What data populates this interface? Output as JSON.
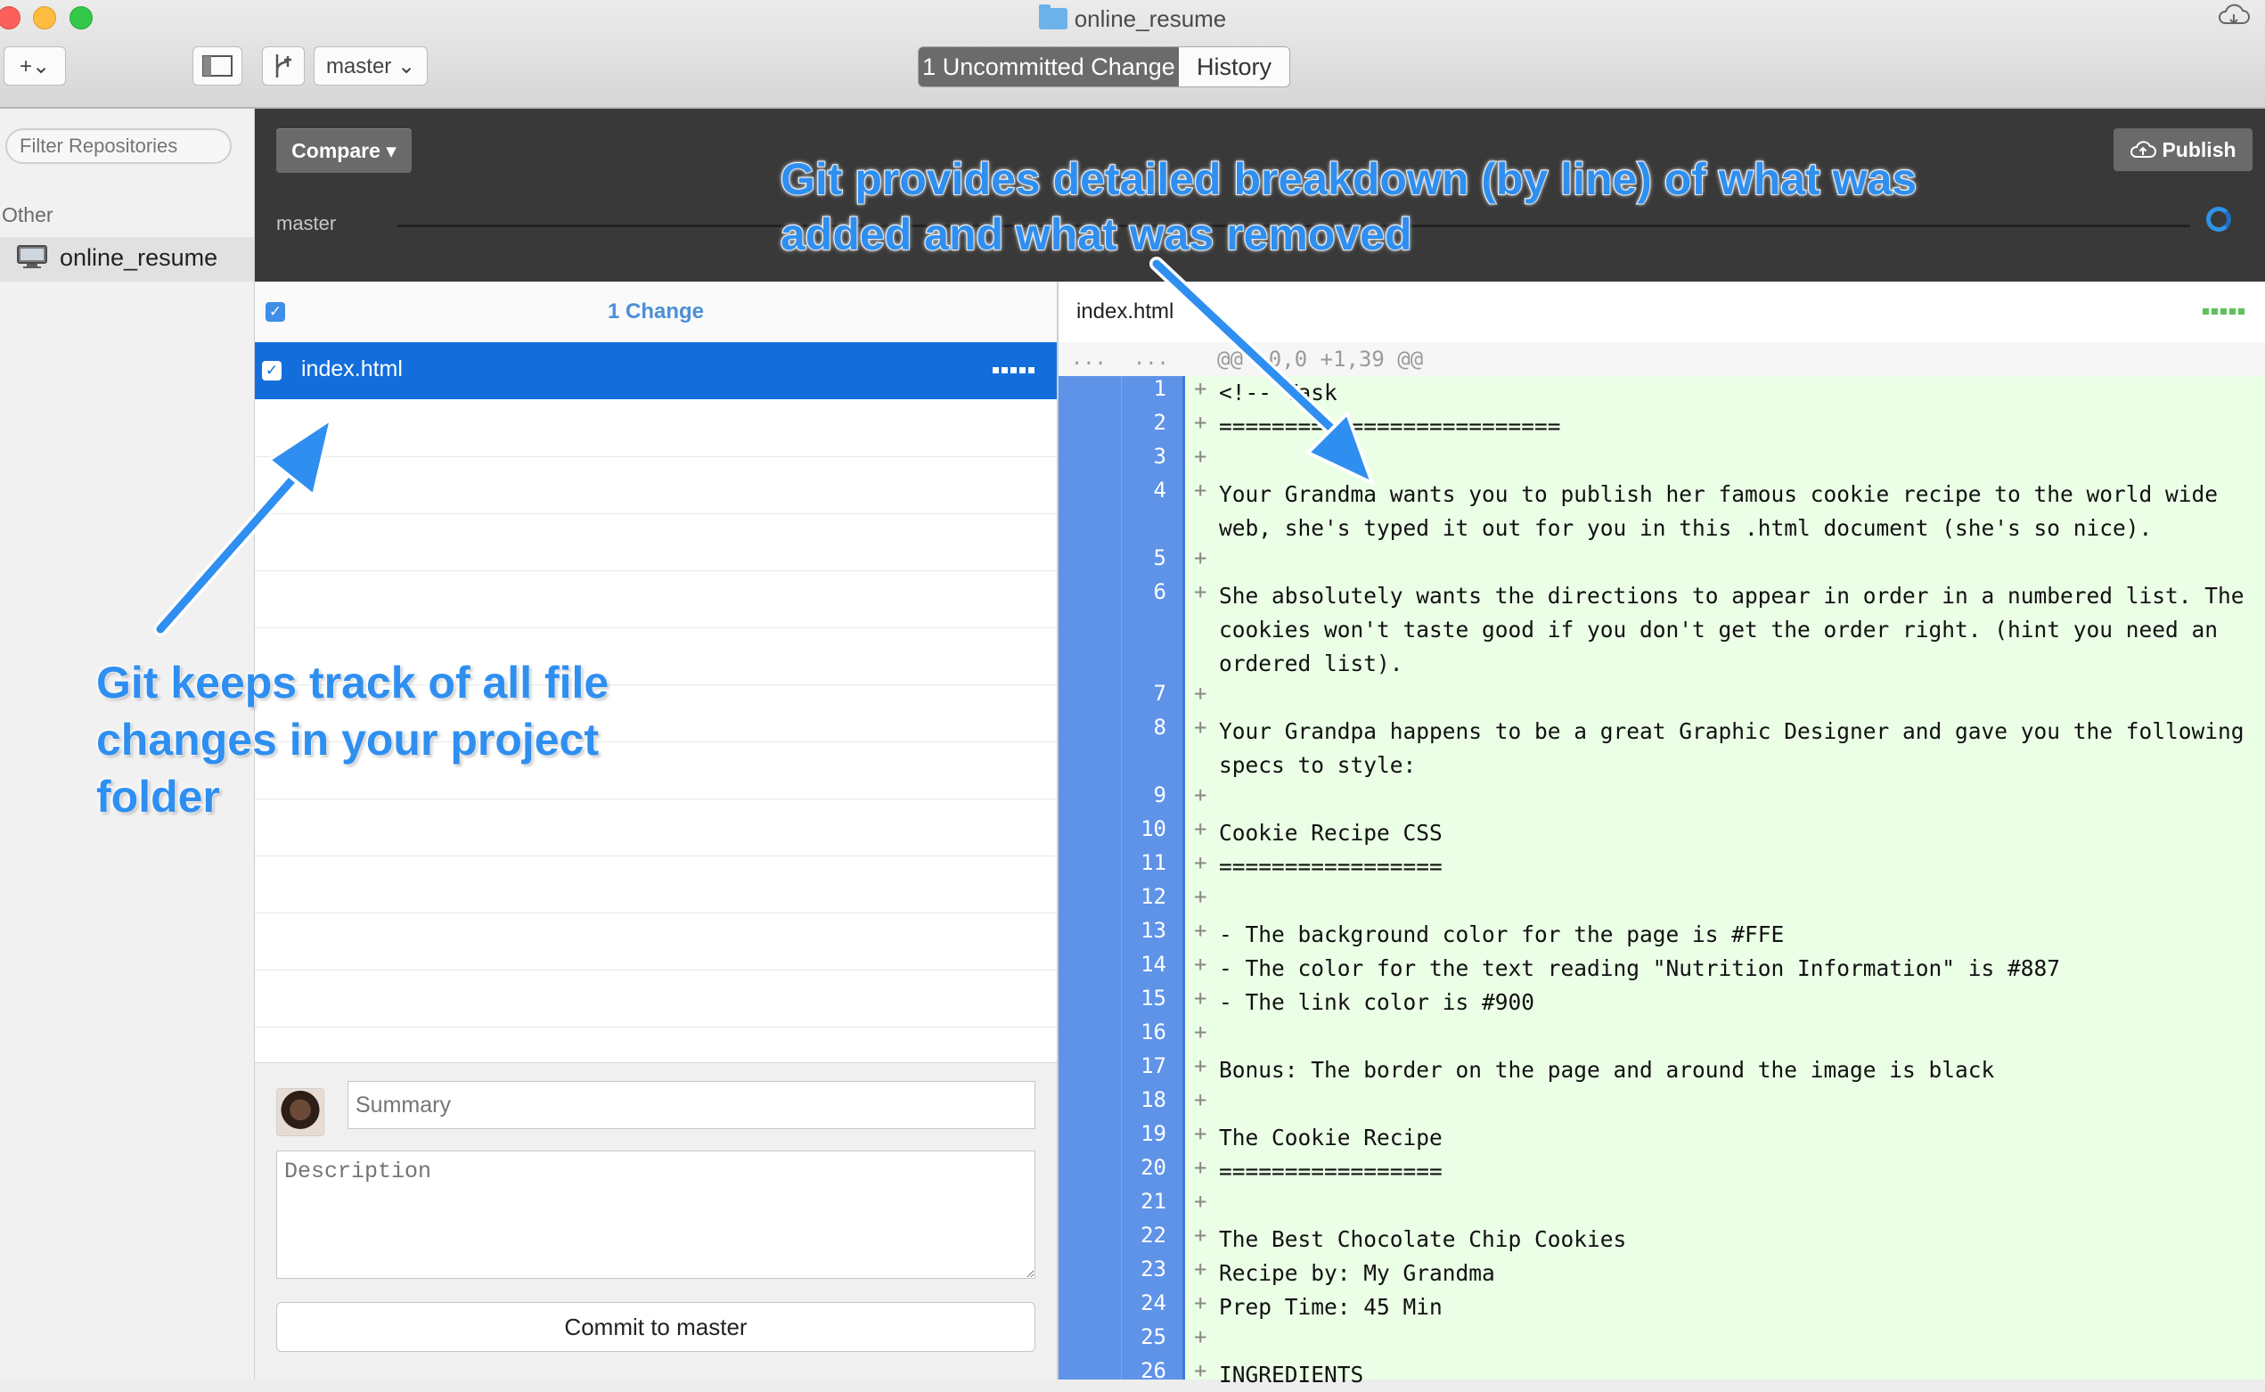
{
  "window": {
    "title": "online_resume",
    "tabs": [
      {
        "label": "1 Uncommitted Change",
        "active": true
      },
      {
        "label": "History",
        "active": false
      }
    ],
    "branch_button": "master ⌄",
    "add_button": "+⌄"
  },
  "sidebar": {
    "filter_placeholder": "Filter Repositories",
    "section_label": "Other",
    "repositories": [
      {
        "name": "online_resume"
      }
    ]
  },
  "header": {
    "compare_label": "Compare ▾",
    "publish_label": "Publish",
    "branch": "master"
  },
  "changes": {
    "count_label": "1 Change",
    "files": [
      {
        "name": "index.html",
        "checked": true
      }
    ]
  },
  "commit": {
    "summary_placeholder": "Summary",
    "description_placeholder": "Description",
    "commit_button": "Commit to master"
  },
  "diff": {
    "file": "index.html",
    "hunk_old": "...",
    "hunk_new": "...",
    "hunk_header": "@@ -0,0 +1,39 @@",
    "lines": [
      {
        "n": "1",
        "text": "<!-- Task"
      },
      {
        "n": "2",
        "text": "=========================="
      },
      {
        "n": "3",
        "text": ""
      },
      {
        "n": "4",
        "text": "Your Grandma wants you to publish her famous cookie recipe to the world wide web, she's typed it out for you in this .html document (she's so nice)."
      },
      {
        "n": "5",
        "text": ""
      },
      {
        "n": "6",
        "text": "She absolutely wants the directions to appear in order in a numbered list. The cookies won't taste good if you don't get the order right. (hint you need an ordered list)."
      },
      {
        "n": "7",
        "text": ""
      },
      {
        "n": "8",
        "text": "Your Grandpa happens to be a great Graphic Designer and gave you the following specs to style:"
      },
      {
        "n": "9",
        "text": ""
      },
      {
        "n": "10",
        "text": "Cookie Recipe CSS"
      },
      {
        "n": "11",
        "text": "================="
      },
      {
        "n": "12",
        "text": ""
      },
      {
        "n": "13",
        "text": "- The background color for the page is #FFE"
      },
      {
        "n": "14",
        "text": "- The color for the text reading \"Nutrition Information\" is #887"
      },
      {
        "n": "15",
        "text": "- The link color is #900"
      },
      {
        "n": "16",
        "text": ""
      },
      {
        "n": "17",
        "text": "Bonus: The border on the page and around the image is black"
      },
      {
        "n": "18",
        "text": ""
      },
      {
        "n": "19",
        "text": "The Cookie Recipe"
      },
      {
        "n": "20",
        "text": "================="
      },
      {
        "n": "21",
        "text": ""
      },
      {
        "n": "22",
        "text": "The Best Chocolate Chip Cookies"
      },
      {
        "n": "23",
        "text": "Recipe by: My Grandma"
      },
      {
        "n": "24",
        "text": "Prep Time: 45 Min"
      },
      {
        "n": "25",
        "text": ""
      },
      {
        "n": "26",
        "text": "INGREDIENTS"
      }
    ]
  },
  "annotations": {
    "top": "Git provides detailed breakdown (by line) of what was added and what was removed",
    "left": "Git keeps track of all file changes in your project folder"
  },
  "colors": {
    "selection": "#136edb",
    "gutter": "#5f93e8",
    "added_bg": "#eaffe6",
    "annotation": "#2f8ff0"
  }
}
